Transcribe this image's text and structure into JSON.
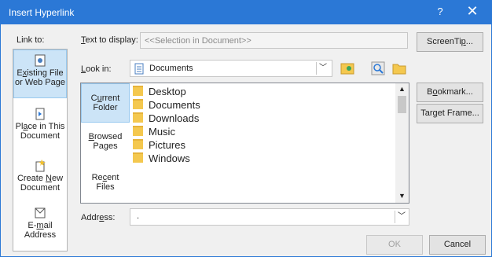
{
  "window": {
    "title": "Insert Hyperlink",
    "help": "?",
    "close": "✕"
  },
  "link_to": {
    "label": "Link to:",
    "items": [
      {
        "line1_pre": "E",
        "line1_u": "x",
        "line1_post": "isting File",
        "line2": "or Web Page",
        "icon": "existing-file-icon"
      },
      {
        "line1_pre": "Pl",
        "line1_u": "a",
        "line1_post": "ce in This",
        "line2": "Document",
        "icon": "place-in-document-icon"
      },
      {
        "line1_pre": "Create ",
        "line1_u": "N",
        "line1_post": "ew",
        "line2": "Document",
        "icon": "create-new-document-icon"
      },
      {
        "line1": "E-",
        "line2_pre": "",
        "line2_u": "m",
        "line2_post": "ail",
        "line3": "Address",
        "icon": "email-address-icon"
      }
    ]
  },
  "text_to_display": {
    "label_u": "T",
    "label_rest": "ext to display:",
    "value": "<<Selection in Document>>"
  },
  "screentip_button": {
    "pre": "ScreenTi",
    "u": "p",
    "post": "..."
  },
  "look_in": {
    "label_u": "L",
    "label_rest": "ook in:",
    "value": "Documents"
  },
  "side_buttons": [
    {
      "line1_pre": "C",
      "line1_u": "u",
      "line1_post": "rrent",
      "line2": "Folder"
    },
    {
      "line1_pre": "",
      "line1_u": "B",
      "line1_post": "rowsed",
      "line2": "Pages"
    },
    {
      "line1_pre": "Re",
      "line1_u": "c",
      "line1_post": "ent",
      "line2": "Files"
    }
  ],
  "files": [
    "Desktop",
    "Documents",
    "Downloads",
    "Music",
    "Pictures",
    "Windows"
  ],
  "bookmark_button": {
    "pre": "B",
    "u": "o",
    "post": "okmark..."
  },
  "target_frame_button": {
    "pre": "Tar",
    "u": "g",
    "post": "et Frame..."
  },
  "address": {
    "label_pre": "Addr",
    "label_u": "e",
    "label_post": "ss:",
    "value": "."
  },
  "ok_button": "OK",
  "cancel_button": "Cancel"
}
